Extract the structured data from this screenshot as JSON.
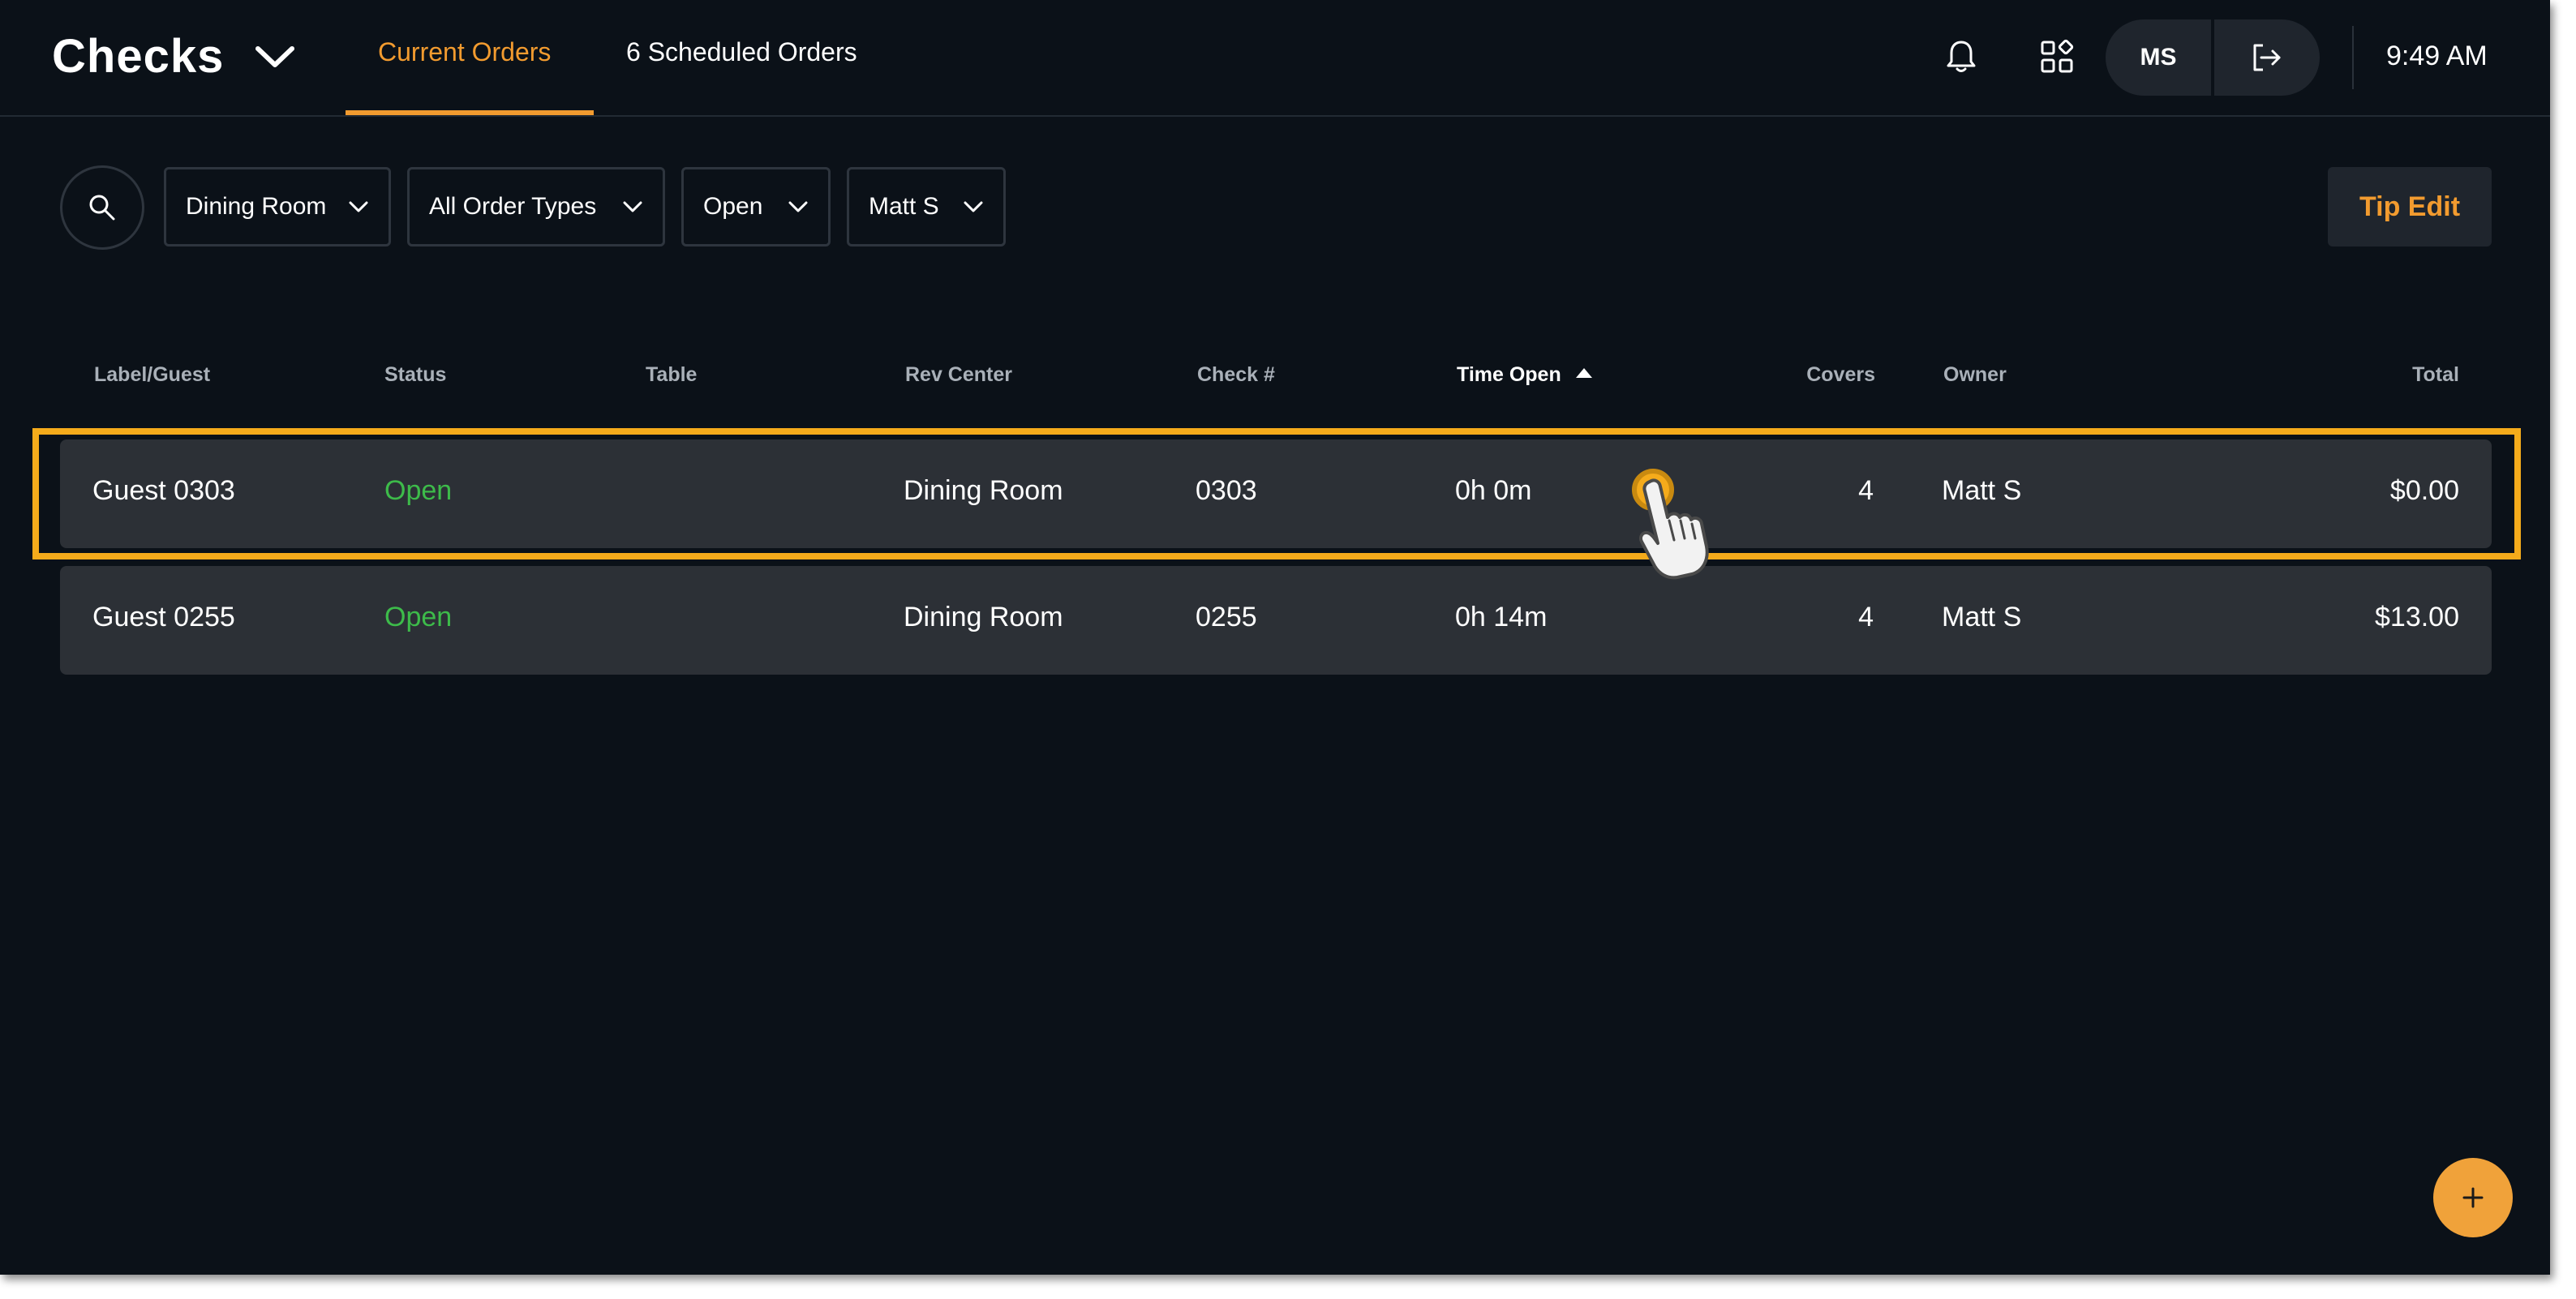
{
  "header": {
    "title": "Checks",
    "tabs": [
      {
        "label": "Current Orders",
        "active": true
      },
      {
        "label": "6 Scheduled Orders",
        "active": false
      }
    ],
    "user_initials": "MS",
    "time": "9:49 AM"
  },
  "filters": {
    "rev_center": "Dining Room",
    "order_type": "All Order Types",
    "status": "Open",
    "owner": "Matt S",
    "tip_edit_label": "Tip Edit"
  },
  "table": {
    "columns": [
      "Label/Guest",
      "Status",
      "Table",
      "Rev Center",
      "Check #",
      "Time Open",
      "Covers",
      "Owner",
      "Total"
    ],
    "sorted_by": "Time Open",
    "rows": [
      {
        "guest": "Guest 0303",
        "status": "Open",
        "table": "",
        "rev_center": "Dining Room",
        "check": "0303",
        "time_open": "0h 0m",
        "covers": "4",
        "owner": "Matt S",
        "total": "$0.00"
      },
      {
        "guest": "Guest 0255",
        "status": "Open",
        "table": "",
        "rev_center": "Dining Room",
        "check": "0255",
        "time_open": "0h 14m",
        "covers": "4",
        "owner": "Matt S",
        "total": "$13.00"
      }
    ]
  },
  "colors": {
    "accent": "#f29b2f",
    "highlight": "#f5ab1b",
    "status_open": "#3dbb4a",
    "background": "#0b1118",
    "row_bg": "#2c3036"
  },
  "icons": [
    "chevron-down-icon",
    "bell-icon",
    "apps-grid-icon",
    "logout-icon",
    "search-icon",
    "plus-icon",
    "pointer-hand-icon"
  ]
}
